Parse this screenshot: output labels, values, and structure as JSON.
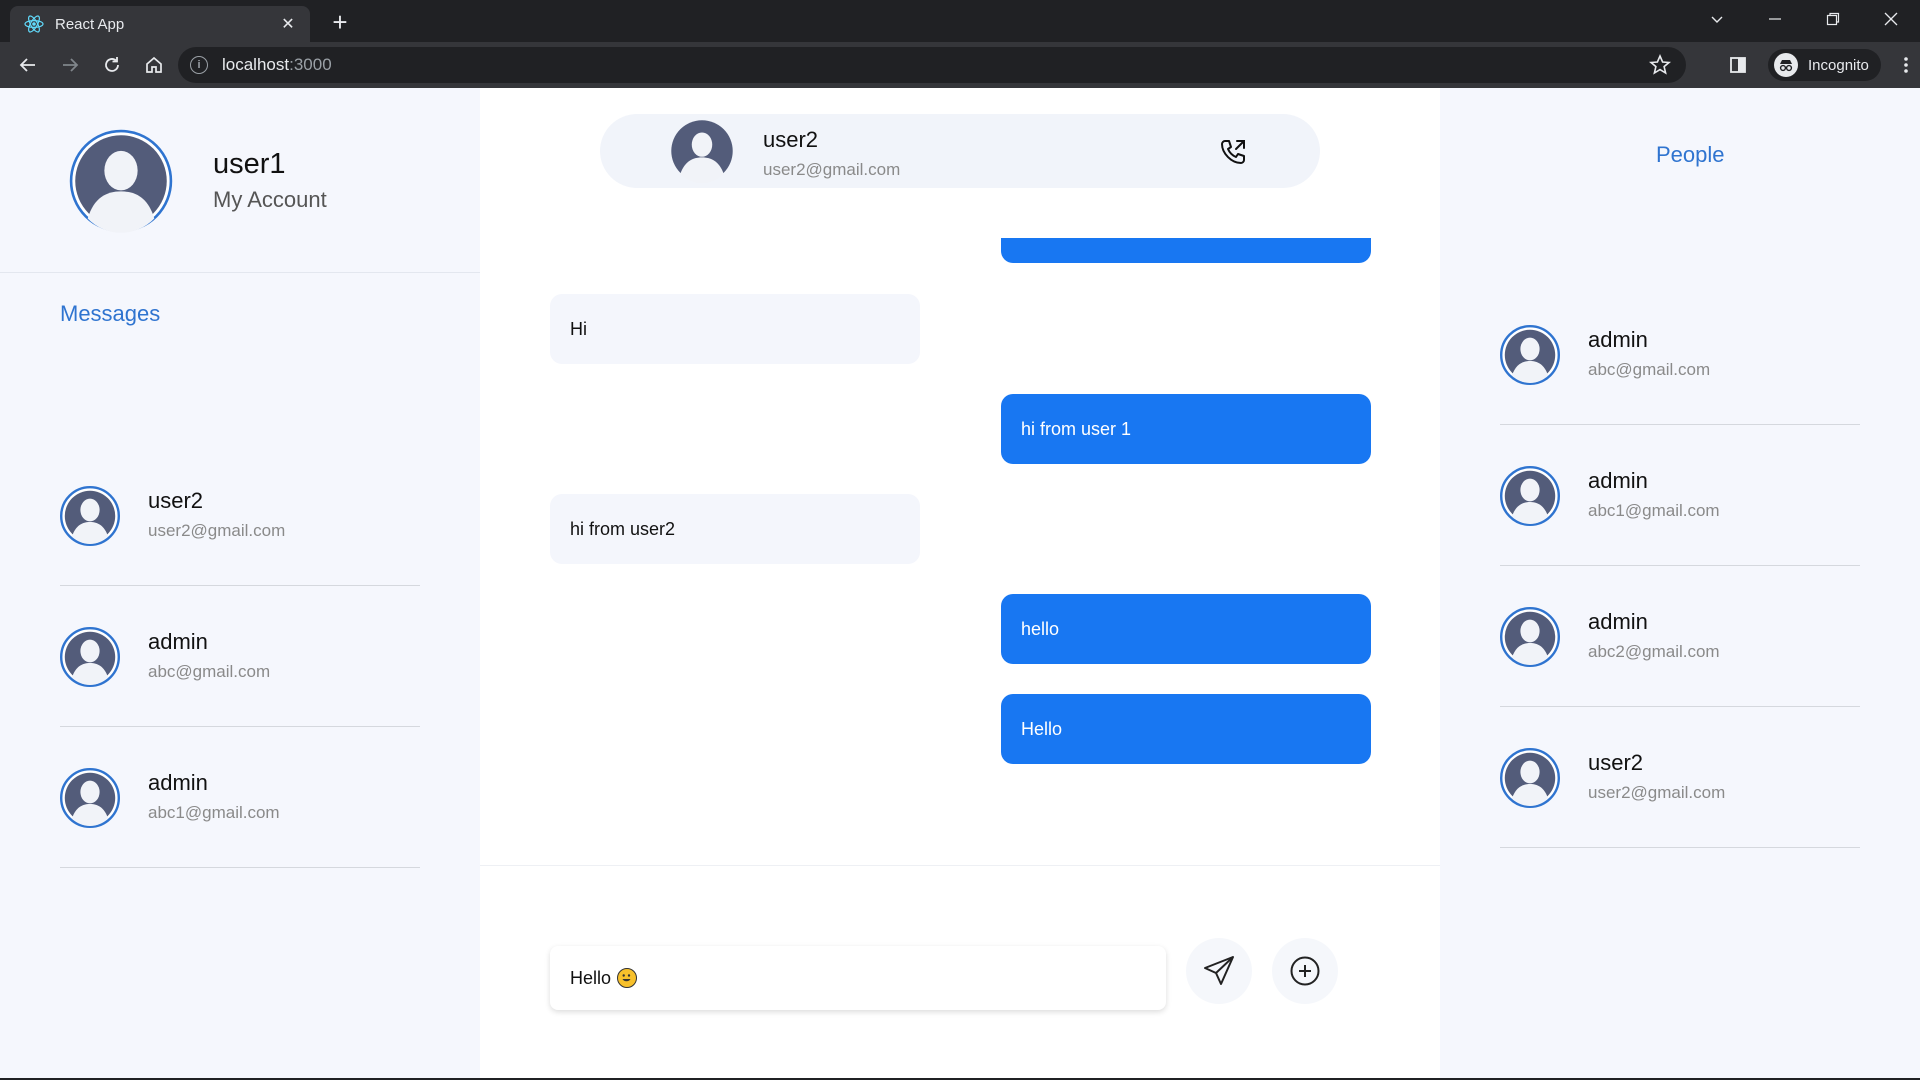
{
  "browser": {
    "tab_title": "React App",
    "url_host": "localhost",
    "url_port": ":3000",
    "incognito_label": "Incognito"
  },
  "account": {
    "name": "user1",
    "subtitle": "My Account"
  },
  "messages_panel": {
    "title": "Messages",
    "items": [
      {
        "name": "user2",
        "email": "user2@gmail.com"
      },
      {
        "name": "admin",
        "email": "abc@gmail.com"
      },
      {
        "name": "admin",
        "email": "abc1@gmail.com"
      }
    ]
  },
  "chat": {
    "header": {
      "name": "user2",
      "email": "user2@gmail.com"
    },
    "messages": [
      {
        "text": "Hi",
        "direction": "incoming"
      },
      {
        "text": "hi from user 1",
        "direction": "outgoing"
      },
      {
        "text": "hi from user2",
        "direction": "incoming"
      },
      {
        "text": "hello",
        "direction": "outgoing"
      },
      {
        "text": "Hello",
        "direction": "outgoing"
      }
    ],
    "compose": {
      "value": "Hello"
    }
  },
  "people_panel": {
    "title": "People",
    "items": [
      {
        "name": "admin",
        "email": "abc@gmail.com"
      },
      {
        "name": "admin",
        "email": "abc1@gmail.com"
      },
      {
        "name": "admin",
        "email": "abc2@gmail.com"
      },
      {
        "name": "user2",
        "email": "user2@gmail.com"
      }
    ]
  },
  "colors": {
    "accent": "#1877f2",
    "link": "#2f74d0",
    "panel_bg": "#f5f7fd",
    "avatar_ring": "#2f74d0",
    "avatar_fill": "#535c7a"
  },
  "icons": {
    "call": "phone-call-icon",
    "send": "send-icon",
    "attach": "plus-circle-icon",
    "avatar": "user-avatar-icon"
  }
}
